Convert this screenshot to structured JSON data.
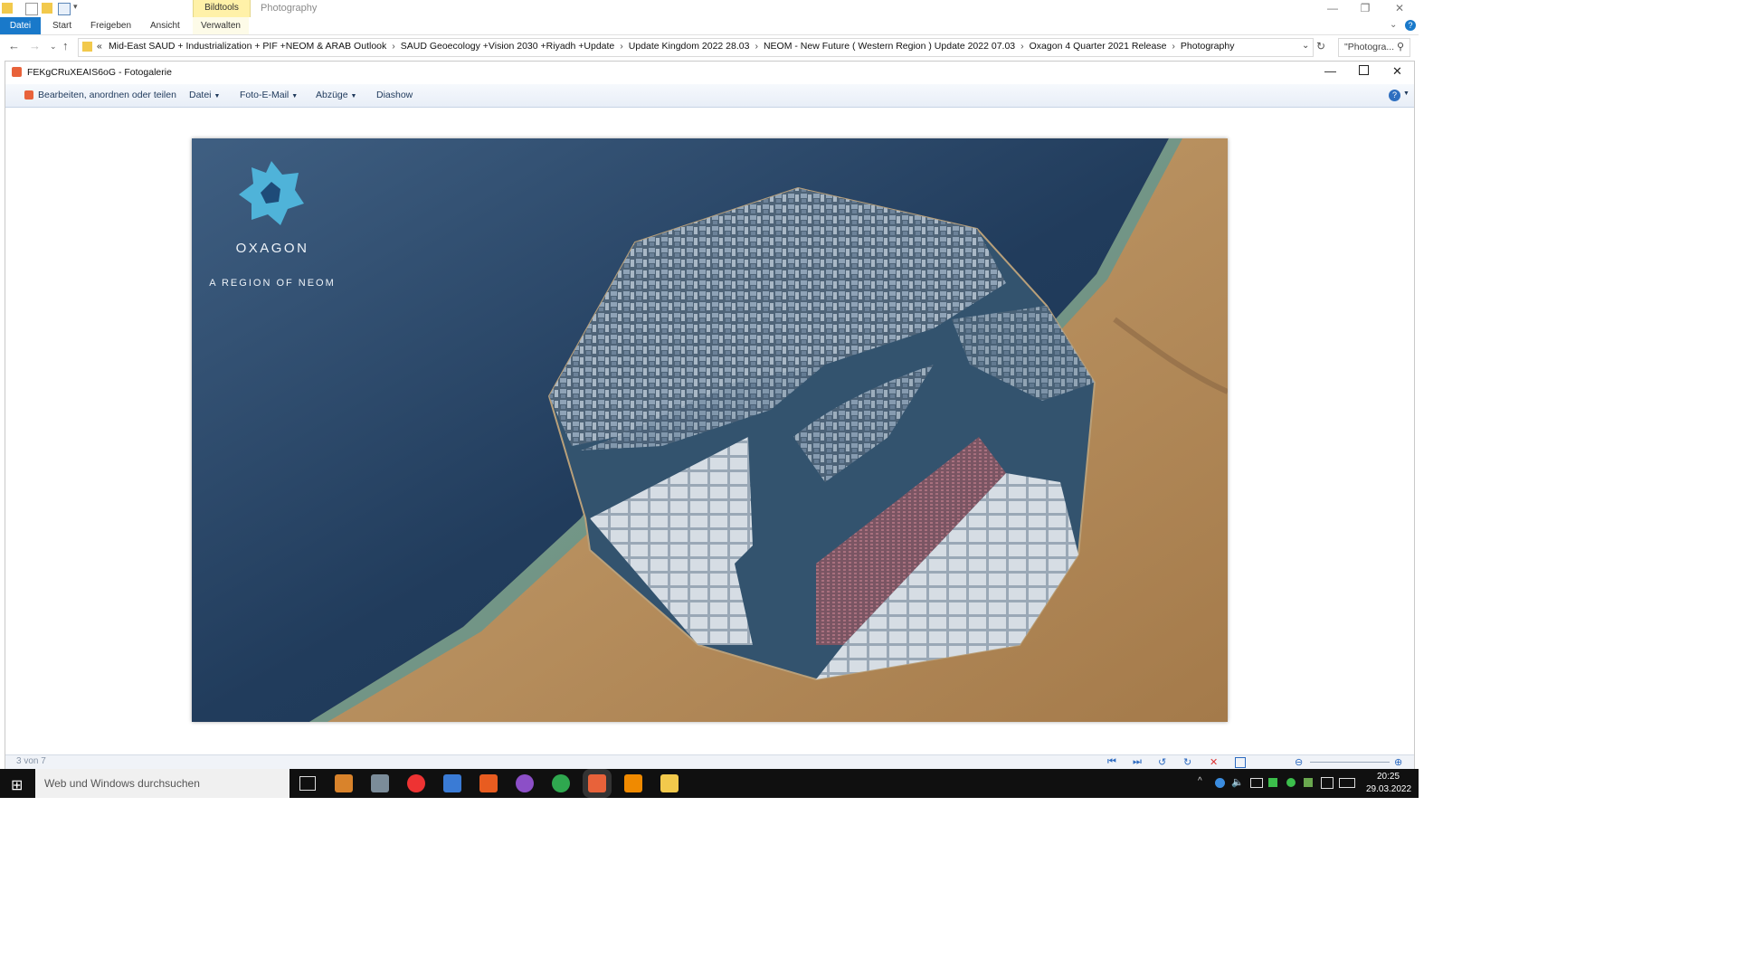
{
  "ribbon": {
    "context_group": "Bildtools",
    "context_title": "Photography",
    "tabs": [
      "Datei",
      "Start",
      "Freigeben",
      "Ansicht",
      "Verwalten"
    ]
  },
  "address": {
    "prefix": "«",
    "crumbs": [
      "Mid-East SAUD + Industrialization + PIF +NEOM & ARAB Outlook",
      "SAUD  Geoecology +Vision 2030 +Riyadh +Update",
      "Update Kingdom 2022 28.03",
      "NEOM - New Future ( Western Region ) Update 2022 07.03",
      "Oxagon 4 Quarter 2021 Release",
      "Photography"
    ],
    "search_placeholder": "\"Photogra..."
  },
  "gallery": {
    "title": "FEKgCRuXEAIS6oG - Fotogalerie",
    "toolbar": {
      "edit": "Bearbeiten, anordnen oder teilen",
      "file": "Datei",
      "photo_email": "Foto-E-Mail",
      "prints": "Abzüge",
      "slideshow": "Diashow"
    },
    "counter": "3 von 7",
    "photo": {
      "brand": "OXAGON",
      "tagline": "A REGION OF NEOM"
    }
  },
  "taskbar": {
    "search_placeholder": "Web und Windows durchsuchen",
    "time": "20:25",
    "date": "29.03.2022"
  },
  "colors": {
    "accent": "#1979ca",
    "context": "#fff1a8",
    "sea": "#2c4a6c",
    "sand": "#c9a06a"
  }
}
